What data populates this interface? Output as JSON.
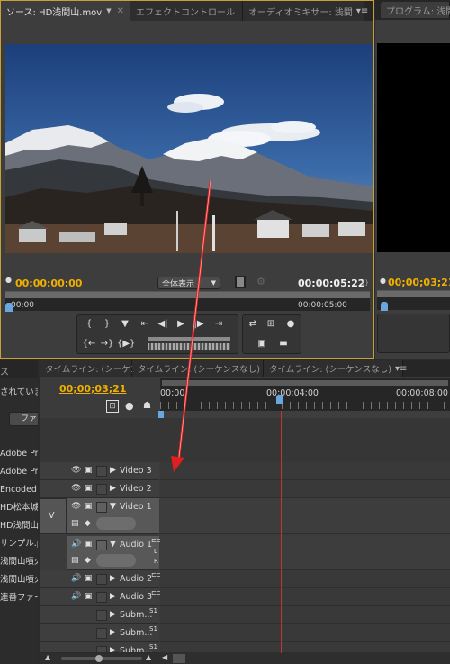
{
  "source_monitor": {
    "tabs": [
      {
        "label": "ソース: HD浅間山.mov",
        "active": true
      },
      {
        "label": "エフェクトコントロール"
      },
      {
        "label": "オーディオミキサー: 浅間"
      }
    ],
    "current_timecode": "00:00:00:00",
    "fit_label": "全体表示",
    "duration_timecode": "00:00:05:22",
    "ruler_start": "00;00",
    "ruler_end": "00:00:05:00"
  },
  "program_monitor": {
    "tab_label": "プログラム: 浅間",
    "current_timecode": "00;00;03;21"
  },
  "project_panel": {
    "tab_label": "ス",
    "status_text": "されていま",
    "filter_button": "ファ",
    "items": [
      "Adobe Pre",
      "Adobe Pre",
      "Encoded F",
      "HD松本城..",
      "HD浅間山..",
      "サンプル.p",
      "浅間山噴火",
      "浅間山噴火",
      "連番ファイ"
    ]
  },
  "timeline": {
    "tabs": [
      "タイムライン: (シーケンスなし)",
      "タイムライン: (シーケンスなし)",
      "タイムライン: (シーケンスなし)"
    ],
    "timecode": "00;00;03;21",
    "ruler_labels": [
      "00;00",
      "00;00;04;00",
      "00;00;08;00"
    ],
    "source_target_label": "V",
    "tracks": {
      "video3": "Video 3",
      "video2": "Video 2",
      "video1": "Video 1",
      "audio1": "Audio 1",
      "audio2": "Audio 2",
      "audio3": "Audio 3",
      "submix1": "Subm...",
      "submix2": "Subm...",
      "submix3": "Subm..."
    },
    "channel_labels": {
      "l": "L",
      "r": "R",
      "s1": "S1",
      "s2": "S1",
      "s3": "S1"
    }
  },
  "colors": {
    "accent_timecode": "#f0b000",
    "playhead": "#c83232",
    "panel_highlight": "#c8a038",
    "annotation_arrow": "#e02020"
  }
}
